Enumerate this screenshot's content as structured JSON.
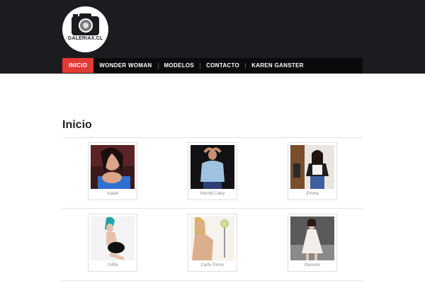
{
  "site": {
    "logo_text": "GALERIAX.CL"
  },
  "nav": {
    "items": [
      {
        "label": "INICIO",
        "active": true
      },
      {
        "label": "WONDER WOMAN",
        "active": false
      },
      {
        "label": "MODELOS",
        "active": false
      },
      {
        "label": "CONTACTO",
        "active": false
      },
      {
        "label": "KAREN GANSTER",
        "active": false
      }
    ]
  },
  "page": {
    "title": "Inicio"
  },
  "gallery": {
    "items": [
      {
        "caption": "Isabel"
      },
      {
        "caption": "Harold Caley"
      },
      {
        "caption": "Emma"
      },
      {
        "caption": "Odha"
      },
      {
        "caption": "Carla Torres"
      },
      {
        "caption": "Damaris"
      }
    ]
  },
  "colors": {
    "header_bg": "#1c1c20",
    "nav_bg": "#0b0b0c",
    "nav_active": "#e53935"
  }
}
